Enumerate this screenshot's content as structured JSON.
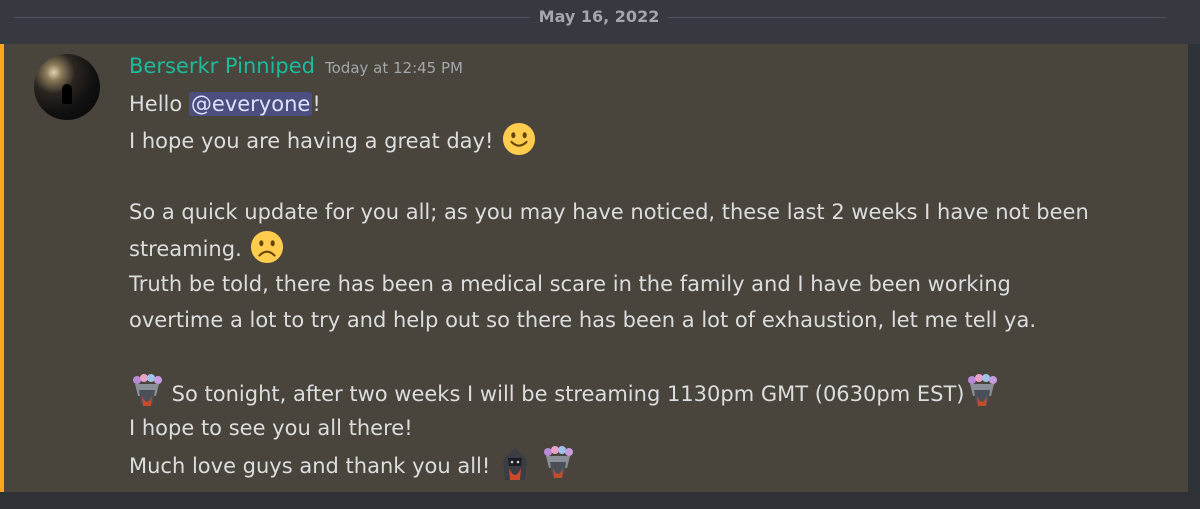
{
  "divider": {
    "date": "May 16, 2022"
  },
  "message": {
    "author": "Berserkr Pinniped",
    "timestamp": "Today at 12:45 PM",
    "line1_prefix": "Hello ",
    "mention": "@everyone",
    "line1_suffix": "!",
    "line2": "I hope you are having a great day!",
    "line3": "So a quick update for you all; as you may have noticed, these last 2 weeks I have not been",
    "line4": "streaming.",
    "line5": "Truth be told, there has been a medical scare in the family and I have been working",
    "line6": "overtime a lot to try and help out so there has been a lot of exhaustion, let me tell ya.",
    "line7": " So tonight, after two weeks I will be streaming 1130pm GMT (0630pm EST)",
    "line8": "I hope to see you all there!",
    "line9": "Much love guys and thank you all! "
  },
  "emojis": {
    "smile": "slightly-smiling-face",
    "frown": "frowning-face",
    "custom_flower": "flower-crown-character",
    "custom_hooded": "hooded-character"
  },
  "colors": {
    "background": "#36393f",
    "highlight": "#49443c",
    "highlight_border": "#faa81a",
    "username": "#1abc9c",
    "mention_bg": "#4b4f80"
  }
}
